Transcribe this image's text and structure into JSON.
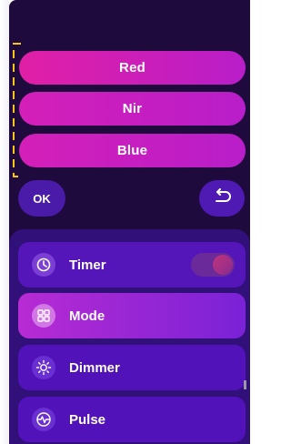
{
  "wavelengths": {
    "red": "Red",
    "nir": "Nir",
    "blue": "Blue"
  },
  "actions": {
    "ok": "OK",
    "back_icon": "undo-arrow-icon"
  },
  "menu": {
    "items": [
      {
        "label": "Timer",
        "icon": "clock-icon",
        "toggle_on": true
      },
      {
        "label": "Mode",
        "icon": "grid-icon"
      },
      {
        "label": "Dimmer",
        "icon": "sun-icon"
      },
      {
        "label": "Pulse",
        "icon": "pulse-icon"
      }
    ]
  },
  "colors": {
    "background": "#1e0a3c",
    "accent_pink": "#e11fa6",
    "accent_purple": "#5212ba",
    "bracket": "#f5c518"
  }
}
